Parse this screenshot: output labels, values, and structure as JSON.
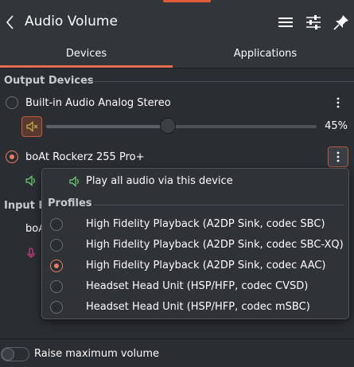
{
  "header": {
    "title": "Audio Volume"
  },
  "tabs": [
    {
      "label": "Devices",
      "active": true
    },
    {
      "label": "Applications",
      "active": false
    }
  ],
  "output": {
    "section_title": "Output Devices",
    "devices": [
      {
        "name": "Built-in Audio Analog Stereo",
        "selected": false,
        "muted": true,
        "volume_percent": 45,
        "volume_label": "45%"
      },
      {
        "name": "boAt Rockerz 255 Pro+",
        "selected": true
      }
    ]
  },
  "input": {
    "section_title_visible": "Input D",
    "device_name_visible": "boA"
  },
  "popup": {
    "play_all_label": "Play all audio via this device",
    "profiles_heading": "Profiles",
    "profiles": [
      {
        "label": "High Fidelity Playback (A2DP Sink, codec SBC)",
        "selected": false
      },
      {
        "label": "High Fidelity Playback (A2DP Sink, codec SBC-XQ)",
        "selected": false
      },
      {
        "label": "High Fidelity Playback (A2DP Sink, codec AAC)",
        "selected": true
      },
      {
        "label": "Headset Head Unit (HSP/HFP, codec CVSD)",
        "selected": false
      },
      {
        "label": "Headset Head Unit (HSP/HFP, codec mSBC)",
        "selected": false
      }
    ]
  },
  "footer": {
    "raise_max_label": "Raise maximum volume",
    "raise_max_on": false
  },
  "colors": {
    "accent": "#e26c4f",
    "speaker_green": "#6fd16f",
    "mic_pink": "#d33c8c",
    "muted_speaker": "#c8b44a"
  }
}
